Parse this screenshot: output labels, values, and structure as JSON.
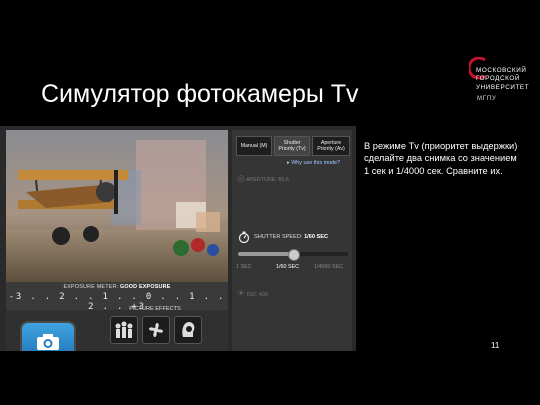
{
  "slide": {
    "title": "Симулятор фотокамеры Tv",
    "instruction": "В режиме Tv (приоритет выдержки) сделайте два снимка со значением 1 сек и 1/4000 сек. Сравните их.",
    "page_number": "11"
  },
  "logo": {
    "lines": [
      "МОСКОВСКИЙ",
      "ГОРОДСКОЙ",
      "УНИВЕРСИТЕТ"
    ],
    "sub": "МГПУ",
    "color": "#c8102e"
  },
  "simulator": {
    "mode_tabs": [
      "Manual (M)",
      "Shutter Priority (Tv)",
      "Aperture Priority (Av)"
    ],
    "active_mode": "Shutter Priority (Tv)",
    "why_link": "Why use this mode?",
    "aperture_label": "APERTURE: f/5.6",
    "shutter_label_prefix": "SHUTTER SPEED:",
    "shutter_value": "1/60 SEC",
    "shutter_ticks": [
      "1 SEC",
      "1/60 SEC",
      "1/4000 SEC"
    ],
    "shutter_position": 0.5,
    "iso_label": "ISO: 400",
    "meter_label_prefix": "EXPOSURE METER:",
    "meter_value": "GOOD EXPOSURE",
    "meter_scale": "-3 . . 2 . . 1 . . 0 . . 1 . . 2 . . +3",
    "effects_label": "PICTURE EFFECTS",
    "effects": [
      "people-effect-icon",
      "fan-effect-icon",
      "portrait-effect-icon"
    ]
  }
}
